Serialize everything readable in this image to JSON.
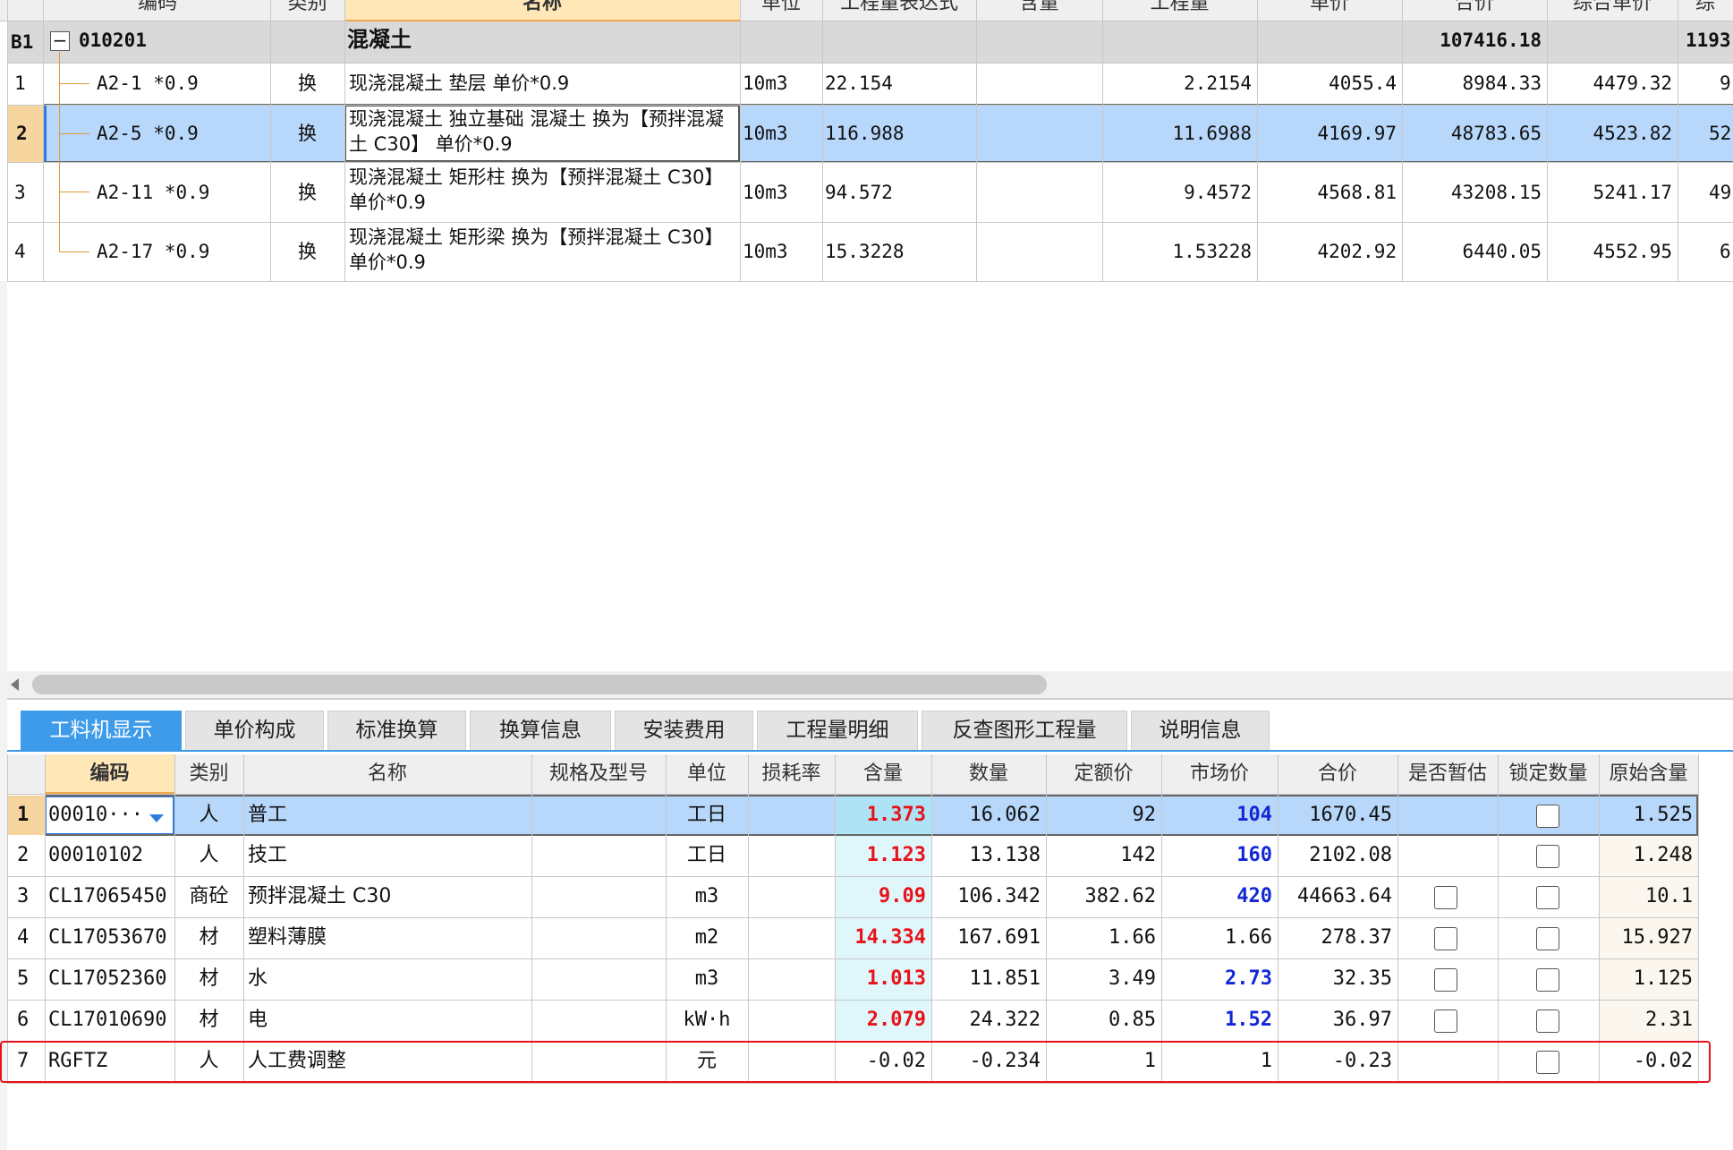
{
  "top_grid": {
    "headers": [
      "编码",
      "类别",
      "名称",
      "单位",
      "工程量表达式",
      "含量",
      "工程量",
      "单价",
      "合价",
      "综合单价",
      "综"
    ],
    "group_row": {
      "id": "B1",
      "code": "010201",
      "name": "混凝土",
      "total": "107416.18",
      "comp_total": "1193"
    },
    "rows": [
      {
        "num": "1",
        "code": "A2-1 *0.9",
        "type": "换",
        "name": "现浇混凝土 垫层  单价*0.9",
        "unit": "10m3",
        "expr": "22.154",
        "content": "",
        "qty": "2.2154",
        "price": "4055.4",
        "total": "8984.33",
        "comp_price": "4479.32",
        "comp_total": "9"
      },
      {
        "num": "2",
        "code": "A2-5 *0.9",
        "type": "换",
        "name": "现浇混凝土 独立基础 混凝土  换为【预拌混凝土 C30】 单价*0.9",
        "unit": "10m3",
        "expr": "116.988",
        "content": "",
        "qty": "11.6988",
        "price": "4169.97",
        "total": "48783.65",
        "comp_price": "4523.82",
        "comp_total": "52"
      },
      {
        "num": "3",
        "code": "A2-11 *0.9",
        "type": "换",
        "name": "现浇混凝土 矩形柱  换为【预拌混凝土 C30】 单价*0.9",
        "unit": "10m3",
        "expr": "94.572",
        "content": "",
        "qty": "9.4572",
        "price": "4568.81",
        "total": "43208.15",
        "comp_price": "5241.17",
        "comp_total": "49"
      },
      {
        "num": "4",
        "code": "A2-17 *0.9",
        "type": "换",
        "name": "现浇混凝土 矩形梁  换为【预拌混凝土 C30】 单价*0.9",
        "unit": "10m3",
        "expr": "15.3228",
        "content": "",
        "qty": "1.53228",
        "price": "4202.92",
        "total": "6440.05",
        "comp_price": "4552.95",
        "comp_total": "6"
      }
    ]
  },
  "tabs": [
    "工料机显示",
    "单价构成",
    "标准换算",
    "换算信息",
    "安装费用",
    "工程量明细",
    "反查图形工程量",
    "说明信息"
  ],
  "bottom_grid": {
    "headers": [
      "编码",
      "类别",
      "名称",
      "规格及型号",
      "单位",
      "损耗率",
      "含量",
      "数量",
      "定额价",
      "市场价",
      "合价",
      "是否暂估",
      "锁定数量",
      "原始含量"
    ],
    "rows": [
      {
        "num": "1",
        "code": "00010···",
        "type": "人",
        "name": "普工",
        "spec": "",
        "unit": "工日",
        "loss": "",
        "content": "1.373",
        "qty": "16.062",
        "base_price": "92",
        "market_price": "104",
        "total": "1670.45",
        "provisional": "",
        "orig": "1.525"
      },
      {
        "num": "2",
        "code": "00010102",
        "type": "人",
        "name": "技工",
        "spec": "",
        "unit": "工日",
        "loss": "",
        "content": "1.123",
        "qty": "13.138",
        "base_price": "142",
        "market_price": "160",
        "total": "2102.08",
        "provisional": "",
        "orig": "1.248"
      },
      {
        "num": "3",
        "code": "CL17065450",
        "type": "商砼",
        "name": "预拌混凝土 C30",
        "spec": "",
        "unit": "m3",
        "loss": "",
        "content": "9.09",
        "qty": "106.342",
        "base_price": "382.62",
        "market_price": "420",
        "total": "44663.64",
        "provisional": "box",
        "orig": "10.1"
      },
      {
        "num": "4",
        "code": "CL17053670",
        "type": "材",
        "name": "塑料薄膜",
        "spec": "",
        "unit": "m2",
        "loss": "",
        "content": "14.334",
        "qty": "167.691",
        "base_price": "1.66",
        "market_price": "1.66",
        "total": "278.37",
        "provisional": "box",
        "orig": "15.927"
      },
      {
        "num": "5",
        "code": "CL17052360",
        "type": "材",
        "name": "水",
        "spec": "",
        "unit": "m3",
        "loss": "",
        "content": "1.013",
        "qty": "11.851",
        "base_price": "3.49",
        "market_price": "2.73",
        "total": "32.35",
        "provisional": "box",
        "orig": "1.125"
      },
      {
        "num": "6",
        "code": "CL17010690",
        "type": "材",
        "name": "电",
        "spec": "",
        "unit": "kW·h",
        "loss": "",
        "content": "2.079",
        "qty": "24.322",
        "base_price": "0.85",
        "market_price": "1.52",
        "total": "36.97",
        "provisional": "box",
        "orig": "2.31"
      },
      {
        "num": "7",
        "code": "RGFTZ",
        "type": "人",
        "name": "人工费调整",
        "spec": "",
        "unit": "元",
        "loss": "",
        "content": "-0.02",
        "qty": "-0.234",
        "base_price": "1",
        "market_price": "1",
        "total": "-0.23",
        "provisional": "",
        "orig": "-0.02"
      }
    ]
  },
  "colors": {
    "selected_row": "#b7d7fb",
    "header_bg": "#efefef",
    "group_bg": "#d9d9d9",
    "active_tab": "#3d9be9",
    "red_value": "#e8121a",
    "blue_value": "#1228d6",
    "highlight_border": "#e8121a"
  }
}
